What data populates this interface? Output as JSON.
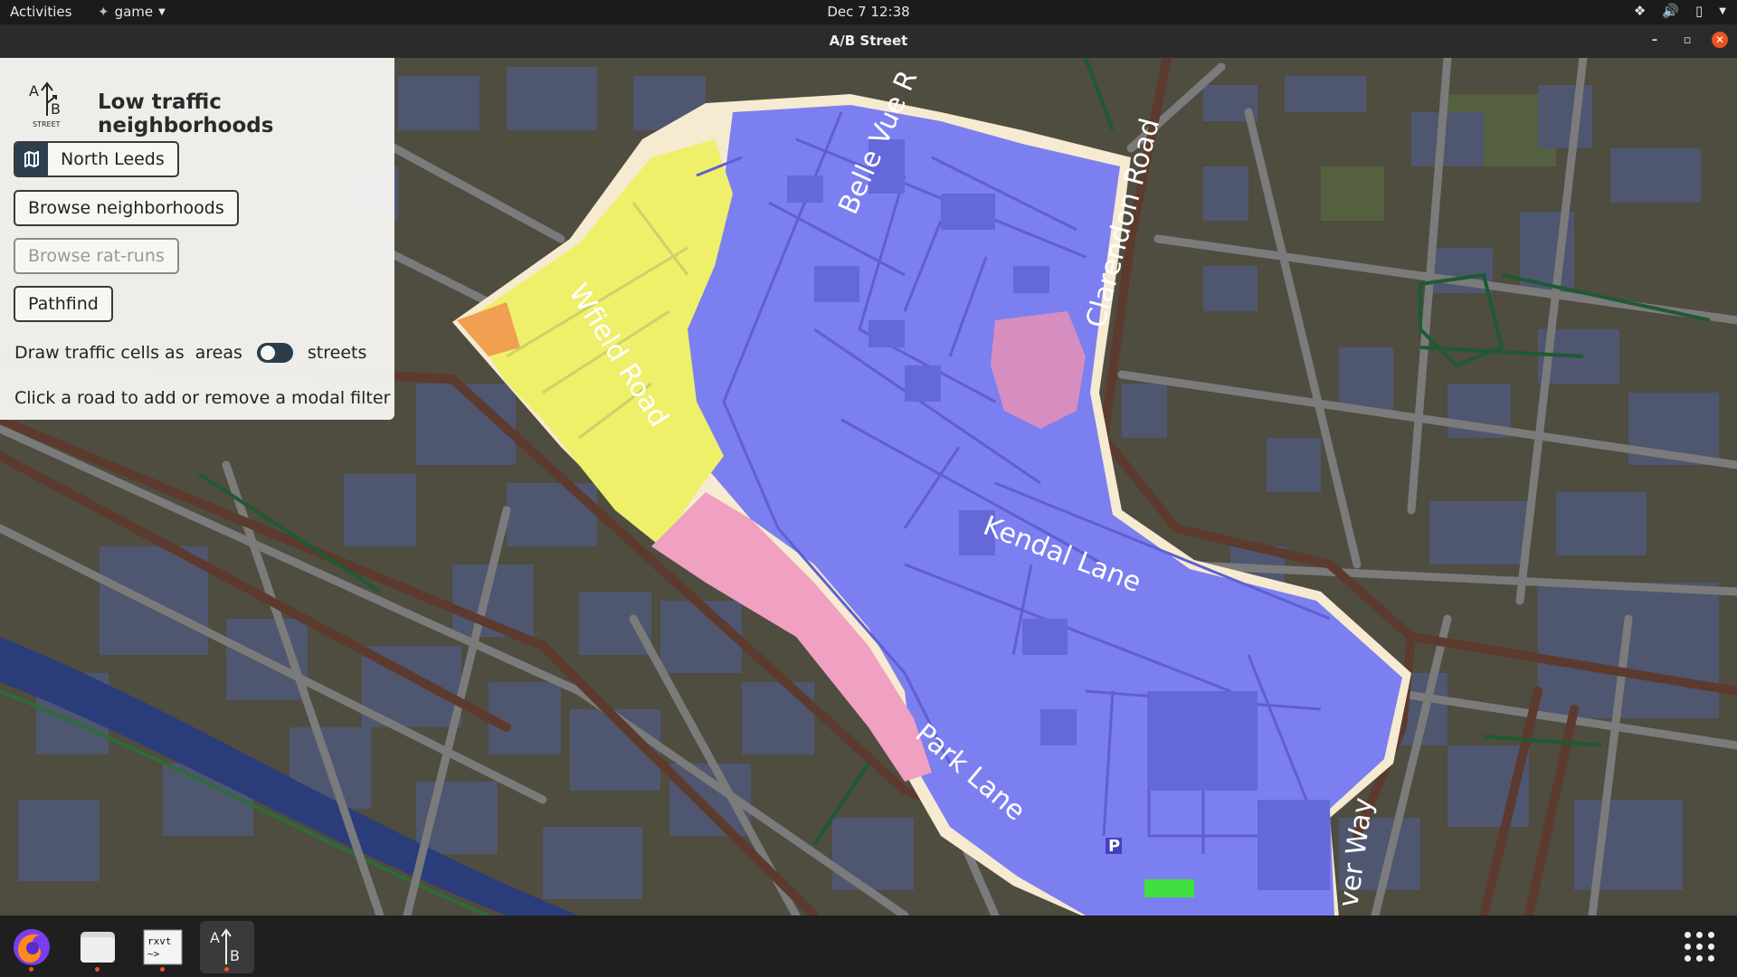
{
  "topbar": {
    "activities": "Activities",
    "app_name": "game",
    "clock": "Dec 7  12:38"
  },
  "window": {
    "title": "A/B Street"
  },
  "panel": {
    "logo_text": "STREET",
    "title": "Low traffic neighborhoods",
    "region_button": "North Leeds",
    "buttons": {
      "browse_neighborhoods": "Browse neighborhoods",
      "browse_rat_runs": "Browse rat-runs",
      "pathfind": "Pathfind"
    },
    "draw_cells_label": "Draw traffic cells as",
    "toggle_left": "areas",
    "toggle_right": "streets",
    "toggle_state": "areas",
    "hint": "Click a road to add or remove a modal filter"
  },
  "map": {
    "street_labels": {
      "belle_vue": "Belle Vue R",
      "clarendon": "Clarendon Road",
      "woodsley": "Wfield Road",
      "kendal": "Kendal Lane",
      "park": "Park Lane",
      "ver_way": "ver Way"
    },
    "cell_colors": {
      "blue": "#7c7ff0",
      "yellow": "#eef06a",
      "pink": "#f0a0c0",
      "orange": "#f0a050",
      "green": "#40e040"
    },
    "parking_symbol": "P"
  },
  "dock": {
    "rxvt_label": "rxvt",
    "items": [
      "firefox-icon",
      "files-icon",
      "terminal-icon",
      "abstreet-icon"
    ]
  }
}
